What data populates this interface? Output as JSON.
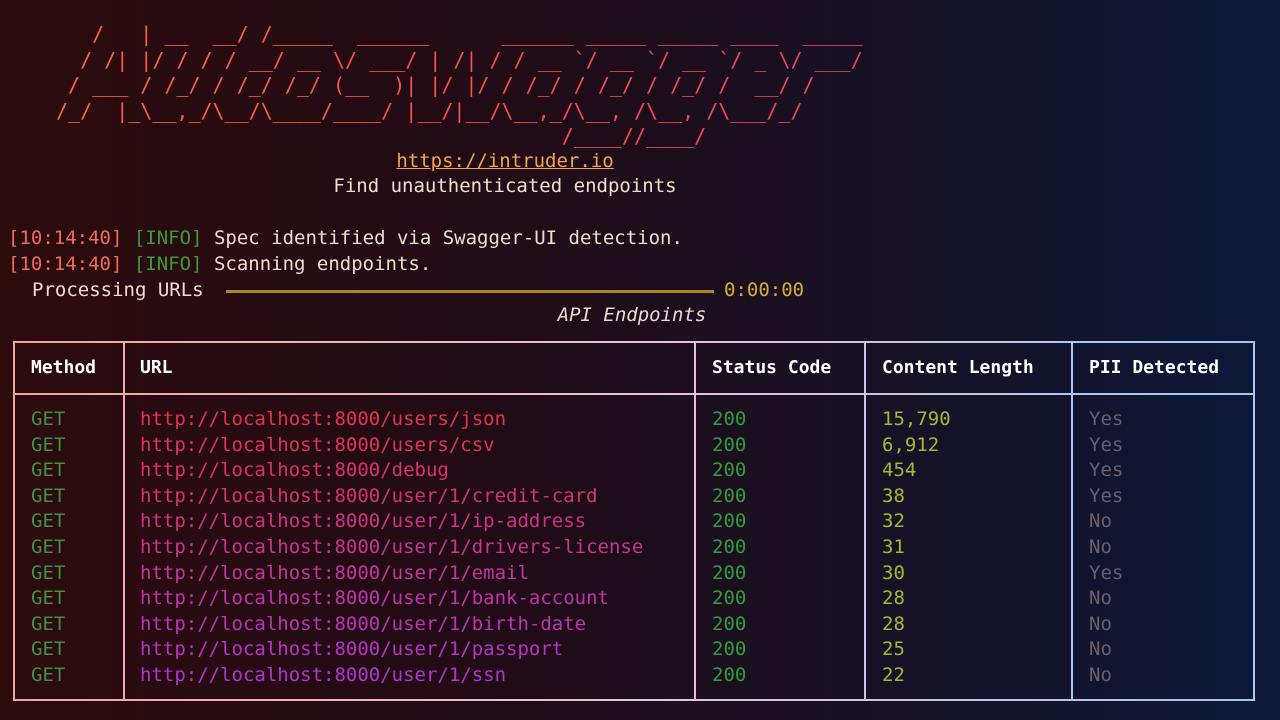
{
  "banner": {
    "ascii_art": "   /   | __  __/ /_____  ______      ______ _____ _____ ____  _____\n  / /| |/ / / / __/ __ \\/ ___/ | /| / / __ `/ __ `/ __ `/ _ \\/ ___/\n / ___ / /_/ / /_/ /_/ (__  )| |/ |/ / /_/ / /_/ / /_/ /  __/ /\n/_/  |_\\__,_/\\__/\\____/____/ |__/|__/\\__,_/\\__, /\\__, /\\___/_/\n                                          /____//____/",
    "link": "https://intruder.io",
    "tagline": "Find unauthenticated endpoints"
  },
  "logs": [
    {
      "timestamp": "[10:14:40]",
      "level": "[INFO]",
      "message": "Spec identified via Swagger-UI detection."
    },
    {
      "timestamp": "[10:14:40]",
      "level": "[INFO]",
      "message": "Scanning endpoints."
    }
  ],
  "progress": {
    "label": "Processing URLs",
    "percent": 100,
    "elapsed": "0:00:00"
  },
  "table": {
    "title": "API Endpoints",
    "columns": [
      "Method",
      "URL",
      "Status Code",
      "Content Length",
      "PII Detected"
    ],
    "rows": [
      {
        "method": "GET",
        "url": "http://localhost:8000/users/json",
        "status": "200",
        "length": "15,790",
        "pii": "Yes"
      },
      {
        "method": "GET",
        "url": "http://localhost:8000/users/csv",
        "status": "200",
        "length": "6,912",
        "pii": "Yes"
      },
      {
        "method": "GET",
        "url": "http://localhost:8000/debug",
        "status": "200",
        "length": "454",
        "pii": "Yes"
      },
      {
        "method": "GET",
        "url": "http://localhost:8000/user/1/credit-card",
        "status": "200",
        "length": "38",
        "pii": "Yes"
      },
      {
        "method": "GET",
        "url": "http://localhost:8000/user/1/ip-address",
        "status": "200",
        "length": "32",
        "pii": "No"
      },
      {
        "method": "GET",
        "url": "http://localhost:8000/user/1/drivers-license",
        "status": "200",
        "length": "31",
        "pii": "No"
      },
      {
        "method": "GET",
        "url": "http://localhost:8000/user/1/email",
        "status": "200",
        "length": "30",
        "pii": "Yes"
      },
      {
        "method": "GET",
        "url": "http://localhost:8000/user/1/bank-account",
        "status": "200",
        "length": "28",
        "pii": "No"
      },
      {
        "method": "GET",
        "url": "http://localhost:8000/user/1/birth-date",
        "status": "200",
        "length": "28",
        "pii": "No"
      },
      {
        "method": "GET",
        "url": "http://localhost:8000/user/1/passport",
        "status": "200",
        "length": "25",
        "pii": "No"
      },
      {
        "method": "GET",
        "url": "http://localhost:8000/user/1/ssn",
        "status": "200",
        "length": "22",
        "pii": "No"
      }
    ]
  },
  "colors": {
    "banner": "#ff5a3c",
    "link": "#f4a646",
    "timestamp": "#f06a5a",
    "info": "#3f9a35",
    "url": "#e0334f",
    "status": "#2f9e3a",
    "length": "#a8b82e",
    "pii": "#6d5f6a"
  }
}
